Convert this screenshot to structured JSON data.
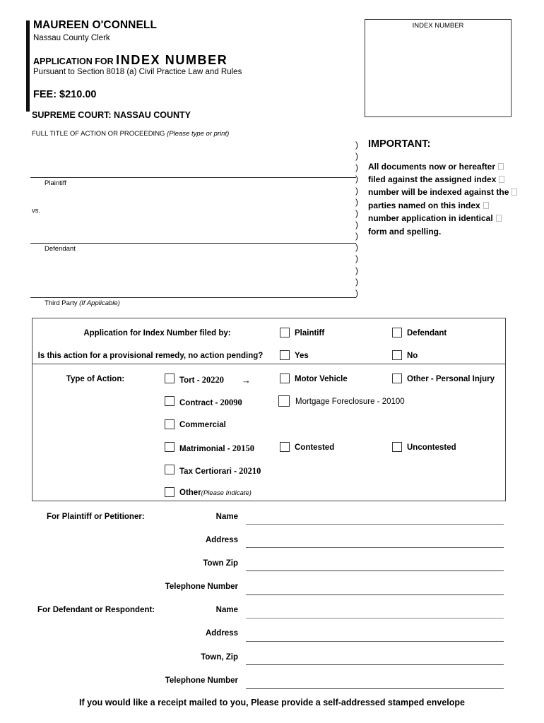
{
  "header": {
    "clerk_name": "MAUREEN O'CONNELL",
    "clerk_title": "Nassau County Clerk",
    "application_prefix": "APPLICATION FOR",
    "application_title": "INDEX NUMBER",
    "pursuant": "Pursuant to Section 8018 (a) Civil Practice Law and Rules",
    "fee": "FEE: $210.00",
    "court": "SUPREME COURT: NASSAU COUNTY",
    "full_title_label": "FULL TITLE OF ACTION OR PROCEEDING",
    "full_title_note": "(Please type or print)"
  },
  "index_box": {
    "label": "INDEX NUMBER"
  },
  "caption": {
    "plaintiff_label": "Plaintiff",
    "vs_label": "vs.",
    "defendant_label": "Defendant",
    "third_party_label": "Third Party",
    "third_party_note": "(If Applicable)",
    "paren": ")"
  },
  "important": {
    "title": "IMPORTANT:",
    "lines": [
      "All documents now or hereafter",
      "filed against the assigned index",
      "number will be indexed against the",
      "parties named on this index",
      "number application in identical",
      "form and spelling."
    ]
  },
  "form": {
    "filed_by": {
      "question": "Application for Index Number filed by:",
      "options": [
        "Plaintiff",
        "Defendant"
      ]
    },
    "provisional": {
      "question": "Is this action for a provisional remedy, no action pending?",
      "options": [
        "Yes",
        "No"
      ]
    },
    "type_of_action": {
      "label": "Type of Action:",
      "tort": {
        "label": "Tort - ",
        "code": "20220",
        "arrow": "→"
      },
      "motor_vehicle": "Motor Vehicle",
      "other_pi": "Other - Personal Injury",
      "contract": {
        "label": "Contract - ",
        "code": "20090"
      },
      "mortgage": "Mortgage Foreclosure - 20100",
      "commercial": "Commercial",
      "matrimonial": {
        "label": "Matrimonial - ",
        "code": "20150"
      },
      "contested": "Contested",
      "uncontested": "Uncontested",
      "tax": {
        "label": "Tax Certiorari - ",
        "code": "20210"
      },
      "other": {
        "label": "Other",
        "note": "(Please Indicate)"
      }
    }
  },
  "parties": {
    "plaintiff": {
      "section": "For Plaintiff or Petitioner:",
      "fields": [
        "Name",
        "Address",
        "Town Zip",
        "Telephone Number"
      ]
    },
    "defendant": {
      "section": "For Defendant or Respondent:",
      "fields": [
        "Name",
        "Address",
        "Town, Zip",
        "Telephone Number"
      ]
    }
  },
  "footer": {
    "note": "If you would like a receipt mailed to you, Please provide a self-addressed stamped envelope"
  }
}
